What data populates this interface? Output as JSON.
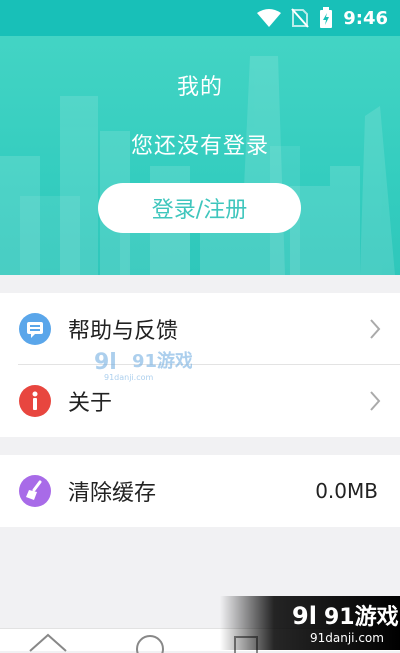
{
  "statusbar": {
    "time": "9:46"
  },
  "header": {
    "title": "我的",
    "subtitle": "您还没有登录",
    "login_button": "登录/注册"
  },
  "menu": {
    "help": {
      "label": "帮助与反馈",
      "icon": "chat-bubble-icon"
    },
    "about": {
      "label": "关于",
      "icon": "info-icon"
    },
    "cache": {
      "label": "清除缓存",
      "value": "0.0MB",
      "icon": "broom-icon"
    }
  },
  "watermark": {
    "brand": "91游戏",
    "site": "91danji.com"
  },
  "colors": {
    "accent": "#34cdbf",
    "help_icon": "#5aa6ea",
    "about_icon": "#e8463f",
    "cache_icon": "#a86be8"
  }
}
